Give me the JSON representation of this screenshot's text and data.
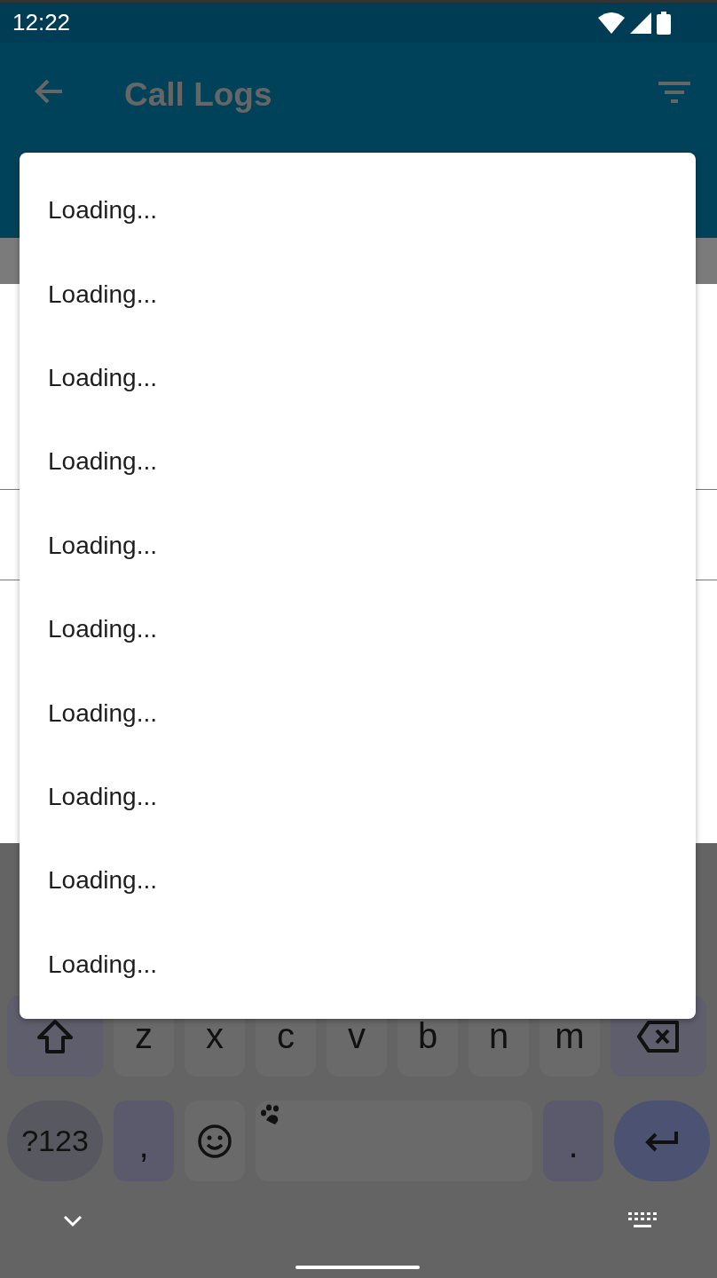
{
  "status_bar": {
    "time": "12:22"
  },
  "app_bar": {
    "title": "Call Logs"
  },
  "dialog": {
    "items": [
      "Loading...",
      "Loading...",
      "Loading...",
      "Loading...",
      "Loading...",
      "Loading...",
      "Loading...",
      "Loading...",
      "Loading...",
      "Loading..."
    ]
  },
  "keyboard": {
    "letter_row": [
      "z",
      "x",
      "c",
      "v",
      "b",
      "n",
      "m"
    ],
    "bottom_row": [
      {
        "kind": "symbols",
        "label": "?123"
      },
      {
        "kind": "char",
        "label": ","
      },
      {
        "kind": "emoji"
      },
      {
        "kind": "space"
      },
      {
        "kind": "char",
        "label": "."
      },
      {
        "kind": "enter"
      }
    ]
  }
}
